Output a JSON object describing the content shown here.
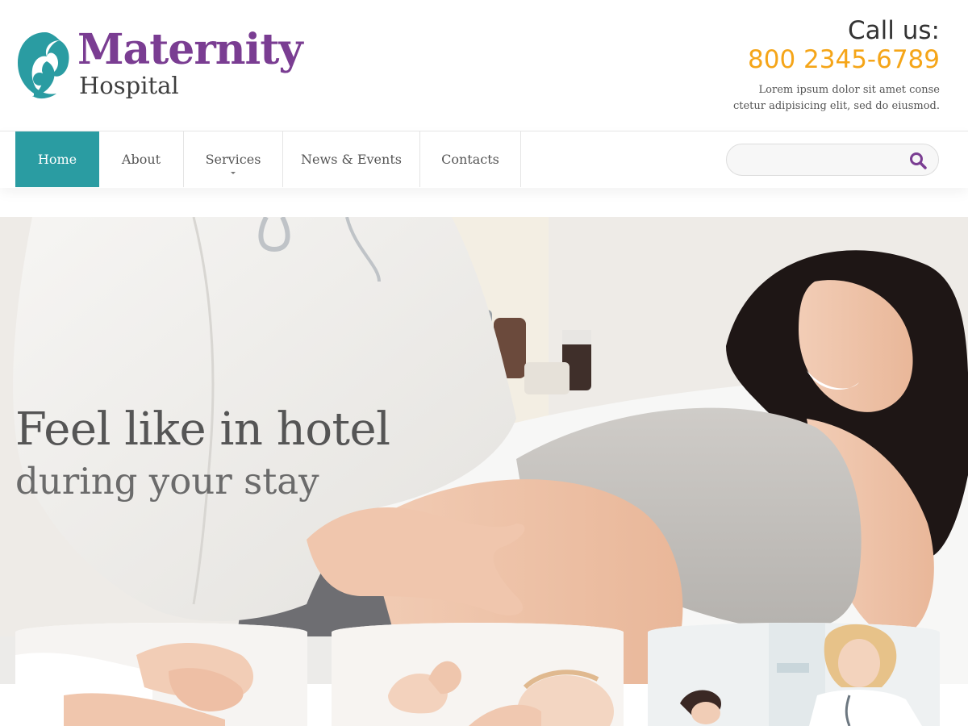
{
  "brand": {
    "name_main": "Maternity",
    "name_sub": "Hospital",
    "logo_icon": "mother-child-icon",
    "primary_color": "#7a3d92",
    "accent_color": "#2a9ca2"
  },
  "contact": {
    "call_label": "Call us:",
    "phone": "800 2345-6789",
    "phone_color": "#f5a518",
    "blurb": "Lorem ipsum dolor sit amet conse ctetur adipisicing elit, sed do eiusmod."
  },
  "nav": {
    "items": [
      {
        "label": "Home",
        "active": true
      },
      {
        "label": "About",
        "active": false
      },
      {
        "label": "Services",
        "active": false,
        "has_dropdown": true
      },
      {
        "label": "News & Events",
        "active": false
      },
      {
        "label": "Contacts",
        "active": false
      }
    ]
  },
  "search": {
    "value": "",
    "icon": "search-icon"
  },
  "hero": {
    "headline": "Feel like in hotel",
    "subline": "during your stay"
  }
}
